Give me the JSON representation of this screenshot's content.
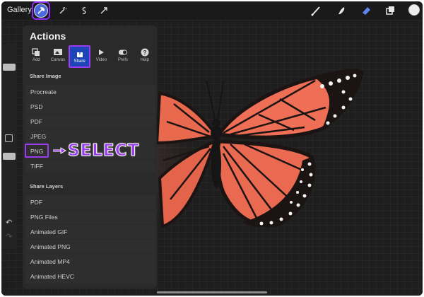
{
  "topbar": {
    "gallery_label": "Gallery",
    "left_icons": [
      "actions-icon",
      "adjustments-icon",
      "selection-icon",
      "transform-icon"
    ],
    "right_icons": [
      "brush-icon",
      "smudge-icon",
      "eraser-icon",
      "layers-icon",
      "color-icon"
    ]
  },
  "panel": {
    "title": "Actions",
    "tabs": [
      {
        "label": "Add",
        "icon": "add-icon"
      },
      {
        "label": "Canvas",
        "icon": "canvas-icon"
      },
      {
        "label": "Share",
        "icon": "share-icon",
        "selected": true
      },
      {
        "label": "Video",
        "icon": "video-icon"
      },
      {
        "label": "Prefs",
        "icon": "prefs-icon"
      },
      {
        "label": "Help",
        "icon": "help-icon"
      }
    ],
    "share_image": {
      "header": "Share Image",
      "items": [
        "Procreate",
        "PSD",
        "PDF",
        "JPEG",
        "PNG",
        "TIFF"
      ]
    },
    "share_layers": {
      "header": "Share Layers",
      "items": [
        "PDF",
        "PNG Files",
        "Animated GIF",
        "Animated PNG",
        "Animated MP4",
        "Animated HEVC"
      ]
    }
  },
  "annotation": {
    "text": "SELECT",
    "color": "#9b3cf0"
  },
  "colors": {
    "accent": "#9b3cf0",
    "share_tab": "#1e45b8",
    "panel_bg": "#2a2a2a",
    "app_bg": "#1c1c1e"
  }
}
